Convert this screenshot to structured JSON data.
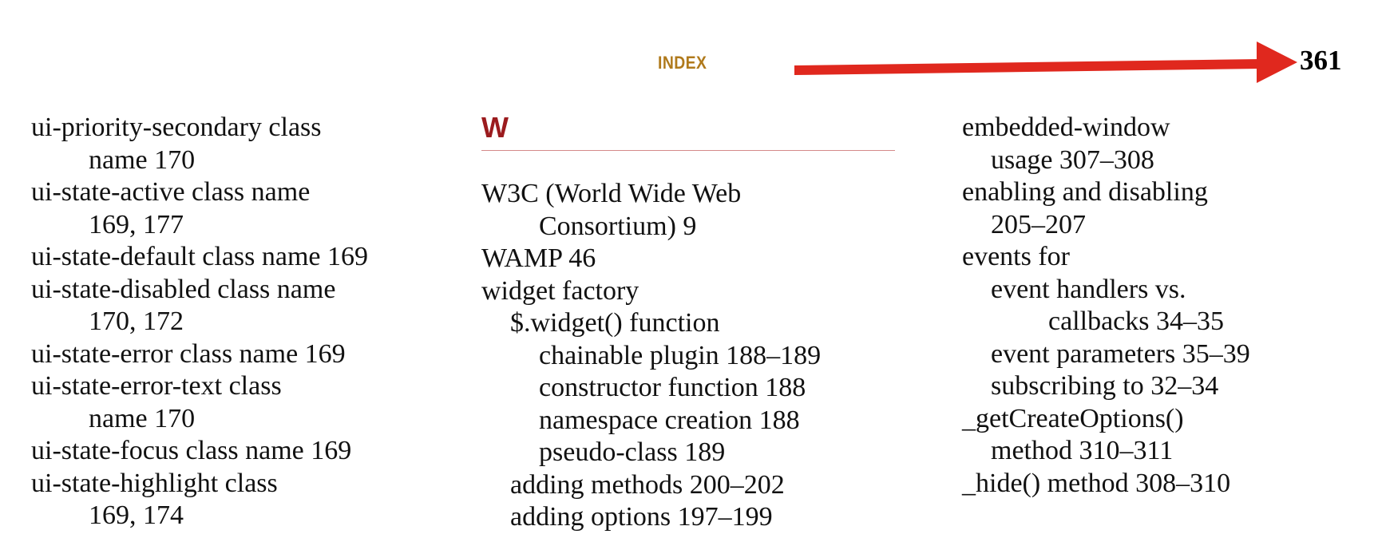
{
  "header": {
    "running_head": "INDEX",
    "page_number": "361",
    "annotation_color": "#e0281e",
    "running_head_color": "#b07a1c",
    "section_letter_color": "#9b1b1e"
  },
  "columns": [
    {
      "lines": [
        {
          "text": "ui-priority-secondary class",
          "indent": 0
        },
        {
          "text": "name  170",
          "indent": 2
        },
        {
          "text": "ui-state-active class name",
          "indent": 0
        },
        {
          "text": "169, 177",
          "indent": 2
        },
        {
          "text": "ui-state-default class name  169",
          "indent": 0
        },
        {
          "text": "ui-state-disabled class name",
          "indent": 0
        },
        {
          "text": "170, 172",
          "indent": 2
        },
        {
          "text": "ui-state-error class name  169",
          "indent": 0
        },
        {
          "text": "ui-state-error-text class",
          "indent": 0
        },
        {
          "text": "name  170",
          "indent": 2
        },
        {
          "text": "ui-state-focus class name  169",
          "indent": 0
        },
        {
          "text": "ui-state-highlight class",
          "indent": 0
        },
        {
          "text": "169, 174",
          "indent": 2
        }
      ]
    },
    {
      "section_letter": "W",
      "lines": [
        {
          "text": "W3C (World Wide Web",
          "indent": 0
        },
        {
          "text": "Consortium)  9",
          "indent": 2
        },
        {
          "text": "WAMP  46",
          "indent": 0
        },
        {
          "text": "widget factory",
          "indent": 0
        },
        {
          "text": "$.widget() function",
          "indent": 1
        },
        {
          "text": "chainable plugin  188–189",
          "indent": 2
        },
        {
          "text": "constructor function  188",
          "indent": 2
        },
        {
          "text": "namespace creation  188",
          "indent": 2
        },
        {
          "text": "pseudo-class  189",
          "indent": 2
        },
        {
          "text": "adding methods  200–202",
          "indent": 1
        },
        {
          "text": "adding options  197–199",
          "indent": 1
        }
      ]
    },
    {
      "lines": [
        {
          "text": "embedded-window",
          "indent": 0
        },
        {
          "text": "usage  307–308",
          "indent": 1
        },
        {
          "text": "enabling and disabling",
          "indent": 0
        },
        {
          "text": "205–207",
          "indent": 1
        },
        {
          "text": "events for",
          "indent": 0
        },
        {
          "text": "event handlers vs.",
          "indent": 1
        },
        {
          "text": "callbacks  34–35",
          "indent": 3
        },
        {
          "text": "event parameters  35–39",
          "indent": 1
        },
        {
          "text": "subscribing to  32–34",
          "indent": 1
        },
        {
          "text": "_getCreateOptions()",
          "indent": 0
        },
        {
          "text": "method  310–311",
          "indent": 1
        },
        {
          "text": "_hide() method  308–310",
          "indent": 0
        }
      ]
    }
  ]
}
